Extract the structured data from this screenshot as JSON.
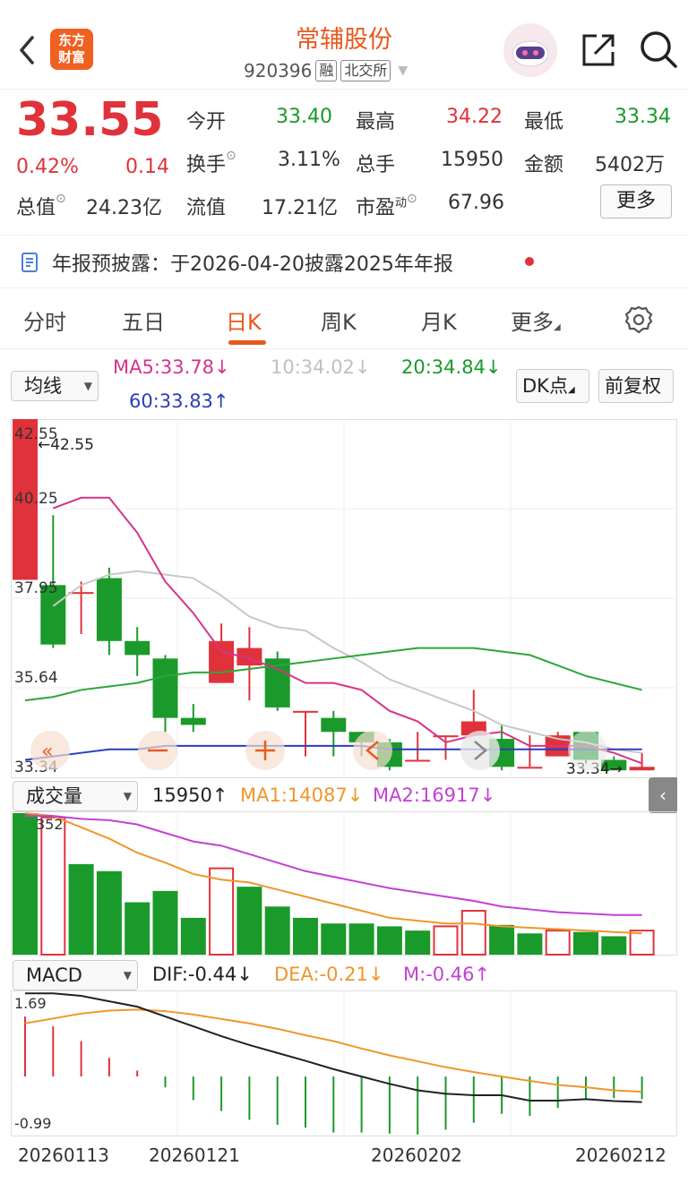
{
  "header": {
    "title": "常辅股份",
    "code": "920396",
    "tag_margin": "融",
    "tag_exchange": "北交所",
    "logo_line1": "东方",
    "logo_line2": "财富"
  },
  "quote": {
    "price": "33.55",
    "change_pct": "0.42%",
    "change": "0.14",
    "open_label": "今开",
    "open": "33.40",
    "high_label": "最高",
    "high": "34.22",
    "low_label": "最低",
    "low": "33.34",
    "turnover_label": "换手",
    "turnover": "3.11%",
    "volume_label": "总手",
    "volume": "15950",
    "amount_label": "金额",
    "amount": "5402万",
    "mktcap_label": "总值",
    "mktcap": "24.23亿",
    "float_label": "流值",
    "float": "17.21亿",
    "pe_label": "市盈",
    "pe_sup": "动",
    "pe": "67.96",
    "more_label": "更多"
  },
  "notice": {
    "text": "年报预披露：于2026-04-20披露2025年年报"
  },
  "tabs": [
    "分时",
    "五日",
    "日K",
    "周K",
    "月K",
    "更多"
  ],
  "active_tab": "日K",
  "kline": {
    "ma_select": "均线",
    "ma5": "MA5:33.78↓",
    "ma10": "10:34.02↓",
    "ma20": "20:34.84↓",
    "ma60": "60:33.83↑",
    "dk_label": "DK点",
    "adjust_label": "前复权",
    "axis": [
      "42.55",
      "40.25",
      "37.95",
      "35.64",
      "33.34"
    ],
    "max_label": "←42.55",
    "min_label": "33.34→",
    "candles": [
      {
        "o": 37.95,
        "c": 42.55,
        "h": 42.55,
        "l": 37.95
      },
      {
        "o": 37.8,
        "c": 36.1,
        "h": 39.8,
        "l": 36.0
      },
      {
        "o": 37.6,
        "c": 37.6,
        "h": 37.9,
        "l": 36.4
      },
      {
        "o": 38.0,
        "c": 36.2,
        "h": 38.3,
        "l": 35.8
      },
      {
        "o": 36.2,
        "c": 35.8,
        "h": 36.6,
        "l": 35.2
      },
      {
        "o": 35.7,
        "c": 34.0,
        "h": 35.8,
        "l": 33.6
      },
      {
        "o": 34.0,
        "c": 33.8,
        "h": 34.4,
        "l": 33.6
      },
      {
        "o": 35.0,
        "c": 36.2,
        "h": 36.7,
        "l": 35.0
      },
      {
        "o": 35.5,
        "c": 36.0,
        "h": 36.6,
        "l": 34.5
      },
      {
        "o": 35.7,
        "c": 34.3,
        "h": 35.9,
        "l": 34.2
      },
      {
        "o": 34.2,
        "c": 34.2,
        "h": 34.2,
        "l": 32.9
      },
      {
        "o": 34.0,
        "c": 33.6,
        "h": 34.2,
        "l": 32.9
      },
      {
        "o": 33.6,
        "c": 33.3,
        "h": 33.6,
        "l": 32.9
      },
      {
        "o": 33.3,
        "c": 32.6,
        "h": 33.4,
        "l": 32.5
      },
      {
        "o": 32.8,
        "c": 32.8,
        "h": 33.6,
        "l": 32.8
      },
      {
        "o": 33.5,
        "c": 33.5,
        "h": 33.5,
        "l": 32.8
      },
      {
        "o": 33.5,
        "c": 33.9,
        "h": 34.8,
        "l": 33.5
      },
      {
        "o": 33.4,
        "c": 32.6,
        "h": 33.8,
        "l": 32.5
      },
      {
        "o": 32.6,
        "c": 32.6,
        "h": 33.5,
        "l": 32.6
      },
      {
        "o": 32.9,
        "c": 33.5,
        "h": 33.6,
        "l": 32.9
      },
      {
        "o": 33.6,
        "c": 32.8,
        "h": 33.6,
        "l": 32.7
      },
      {
        "o": 32.8,
        "c": 32.5,
        "h": 32.9,
        "l": 32.5
      },
      {
        "o": 32.5,
        "c": 32.6,
        "h": 33.0,
        "l": 32.5
      }
    ],
    "ma5_vals": [
      null,
      40.0,
      40.3,
      40.3,
      39.3,
      37.9,
      37.0,
      35.9,
      35.7,
      35.4,
      35.0,
      35.0,
      34.8,
      34.2,
      33.9,
      33.3,
      33.5,
      33.6,
      33.2,
      33.2,
      33.2,
      33.0,
      32.7
    ],
    "ma10_vals": [
      null,
      37.2,
      37.8,
      38.1,
      38.2,
      38.1,
      38.0,
      37.5,
      36.9,
      36.6,
      36.5,
      36.0,
      35.6,
      35.1,
      34.8,
      34.5,
      34.2,
      33.8,
      33.6,
      33.4,
      33.3,
      33.1,
      33.0
    ],
    "ma20_vals": [
      34.5,
      34.6,
      34.8,
      34.9,
      35.0,
      35.2,
      35.3,
      35.3,
      35.4,
      35.5,
      35.6,
      35.7,
      35.8,
      35.9,
      36.0,
      36.0,
      36.0,
      35.9,
      35.8,
      35.5,
      35.2,
      35.0,
      34.8
    ],
    "ma60_vals": [
      32.8,
      32.9,
      33.0,
      33.1,
      33.1,
      33.2,
      33.2,
      33.2,
      33.2,
      33.2,
      33.2,
      33.2,
      33.2,
      33.1,
      33.1,
      33.1,
      33.1,
      33.1,
      33.1,
      33.1,
      33.1,
      33.1,
      33.1
    ]
  },
  "volume_panel": {
    "select": "成交量",
    "value": "15950↑",
    "ma1": "MA1:14087↓",
    "ma2": "MA2:16917↓",
    "max_label": "352",
    "bars": [
      {
        "v": 100,
        "up": false
      },
      {
        "v": 97,
        "up": true
      },
      {
        "v": 64,
        "up": false
      },
      {
        "v": 59,
        "up": false
      },
      {
        "v": 37,
        "up": false
      },
      {
        "v": 45,
        "up": false
      },
      {
        "v": 26,
        "up": false
      },
      {
        "v": 61,
        "up": true
      },
      {
        "v": 48,
        "up": false
      },
      {
        "v": 34,
        "up": false
      },
      {
        "v": 26,
        "up": false
      },
      {
        "v": 22,
        "up": false
      },
      {
        "v": 22,
        "up": false
      },
      {
        "v": 20,
        "up": false
      },
      {
        "v": 17,
        "up": false
      },
      {
        "v": 20,
        "up": true
      },
      {
        "v": 31,
        "up": true
      },
      {
        "v": 21,
        "up": false
      },
      {
        "v": 15,
        "up": false
      },
      {
        "v": 17,
        "up": true
      },
      {
        "v": 16,
        "up": false
      },
      {
        "v": 13,
        "up": false
      },
      {
        "v": 17,
        "up": true
      }
    ],
    "ma1_vals": [
      100,
      98,
      90,
      82,
      72,
      65,
      57,
      53,
      51,
      46,
      41,
      36,
      31,
      26,
      24,
      22,
      22,
      20,
      19,
      18,
      17,
      16,
      15
    ],
    "ma2_vals": [
      98,
      98,
      96,
      95,
      92,
      86,
      80,
      77,
      71,
      65,
      59,
      55,
      51,
      47,
      44,
      41,
      38,
      34,
      32,
      30,
      29,
      28,
      28
    ]
  },
  "macd_panel": {
    "select": "MACD",
    "dif": "DIF:-0.44↓",
    "dea": "DEA:-0.21↓",
    "m": "M:-0.46↑",
    "axis_top": "1.69",
    "axis_bottom": "-0.99",
    "dif_vals": [
      1.69,
      1.69,
      1.64,
      1.53,
      1.42,
      1.22,
      1.02,
      0.82,
      0.64,
      0.48,
      0.32,
      0.15,
      0.0,
      -0.15,
      -0.28,
      -0.35,
      -0.38,
      -0.38,
      -0.49,
      -0.49,
      -0.46,
      -0.5,
      -0.52
    ],
    "dea_vals": [
      1.08,
      1.18,
      1.28,
      1.34,
      1.36,
      1.33,
      1.26,
      1.17,
      1.08,
      0.97,
      0.84,
      0.72,
      0.57,
      0.43,
      0.31,
      0.19,
      0.09,
      0.0,
      -0.09,
      -0.17,
      -0.22,
      -0.28,
      -0.31
    ],
    "m_vals": [
      1.22,
      1.02,
      0.72,
      0.38,
      0.12,
      -0.22,
      -0.48,
      -0.7,
      -0.88,
      -0.98,
      -1.04,
      -1.14,
      -1.14,
      -1.16,
      -1.18,
      -1.08,
      -0.94,
      -0.76,
      -0.8,
      -0.64,
      -0.48,
      -0.44,
      -0.46
    ]
  },
  "dates": [
    "20260113",
    "20260121",
    "20260202",
    "20260212"
  ]
}
